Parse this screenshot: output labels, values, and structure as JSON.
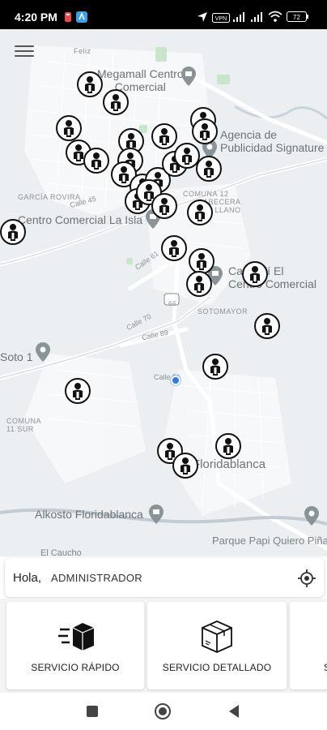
{
  "status_bar": {
    "time": "4:20 PM",
    "battery": "72",
    "icons": [
      "whatsapp-icon",
      "notification-icon",
      "location-arrow-icon",
      "vpn-icon",
      "signal-icon",
      "signal-icon",
      "wifi-icon",
      "battery-icon"
    ]
  },
  "map": {
    "menu_icon": "hamburger-menu-icon",
    "labels": {
      "feliz": "Feliz",
      "megamall": "Megamall Centro\nComercial",
      "agencia": "Agencia de\nPublicidad Signature",
      "garcia": "GARCÍA ROVIRA",
      "comuna12": "COMUNA 12",
      "cabecera": "CABECERA\nLLANO",
      "calle45": "Calle 45",
      "isla": "Centro Comercial La Isla",
      "calle61": "Calle 61",
      "caracoli": "Caracolí El\nCentro Comercial",
      "sotomayor": "SOTOMAYOR",
      "calle70": "Calle 70",
      "calle89": "Calle 89",
      "soto": "Soto 1",
      "calle56": "Calle 56",
      "comuna11": "COMUNA\n11 SUR",
      "floridablanca": "Floridablanca",
      "alkosto": "Alkosto Floridablanca",
      "parque": "Parque Papi Quiero Piña",
      "caucho": "El Caucho",
      "route66": "66"
    },
    "marker_icon": "person-marker-icon"
  },
  "greeting": {
    "hola": "Hola,",
    "name": "ADMINISTRADOR",
    "locate_icon": "my-location-icon"
  },
  "services": [
    {
      "label": "SERVICIO RÁPIDO",
      "icon": "fast-box-icon"
    },
    {
      "label": "SERVICIO DETALLADO",
      "icon": "package-icon"
    },
    {
      "label": "S",
      "icon": ""
    }
  ],
  "nav": [
    "recent-apps-icon",
    "home-icon",
    "back-icon"
  ]
}
